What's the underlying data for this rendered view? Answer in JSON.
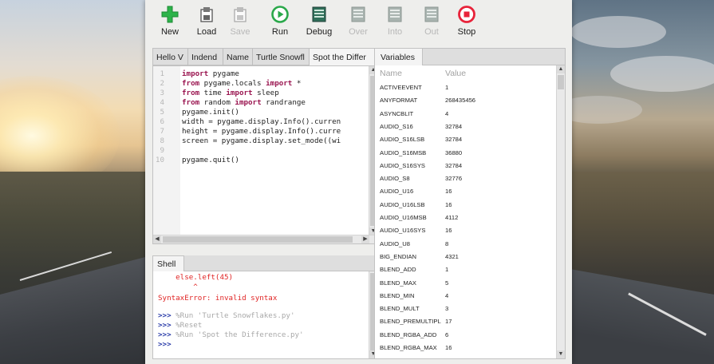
{
  "toolbar": {
    "buttons": [
      {
        "label": "New",
        "icon": "plus-icon",
        "enabled": true
      },
      {
        "label": "Load",
        "icon": "load-icon",
        "enabled": true
      },
      {
        "label": "Save",
        "icon": "save-icon",
        "enabled": false
      },
      {
        "label": "Run",
        "icon": "run-icon",
        "enabled": true
      },
      {
        "label": "Debug",
        "icon": "debug-icon",
        "enabled": true
      },
      {
        "label": "Over",
        "icon": "step-over-icon",
        "enabled": false
      },
      {
        "label": "Into",
        "icon": "step-into-icon",
        "enabled": false
      },
      {
        "label": "Out",
        "icon": "step-out-icon",
        "enabled": false
      },
      {
        "label": "Stop",
        "icon": "stop-icon",
        "enabled": true
      }
    ]
  },
  "editor": {
    "tabs": [
      "Hello V",
      "Indend",
      "Name",
      "Turtle Snowfl",
      "Spot the Differ"
    ],
    "active_tab": 4,
    "line_numbers": [
      "1",
      "2",
      "3",
      "4",
      "5",
      "6",
      "7",
      "8",
      "9",
      "10"
    ],
    "lines": [
      {
        "kw1": "import",
        "rest1": " pygame",
        "kw2": "",
        "rest2": ""
      },
      {
        "kw1": "from",
        "rest1": " pygame.locals ",
        "kw2": "import",
        "rest2": " *"
      },
      {
        "kw1": "from",
        "rest1": " time ",
        "kw2": "import",
        "rest2": " sleep"
      },
      {
        "kw1": "from",
        "rest1": " random ",
        "kw2": "import",
        "rest2": " randrange"
      },
      {
        "kw1": "",
        "rest1": "pygame.init()",
        "kw2": "",
        "rest2": ""
      },
      {
        "kw1": "",
        "rest1": "width = pygame.display.Info().curren",
        "kw2": "",
        "rest2": ""
      },
      {
        "kw1": "",
        "rest1": "height = pygame.display.Info().curre",
        "kw2": "",
        "rest2": ""
      },
      {
        "kw1": "",
        "rest1": "screen = pygame.display.set_mode((wi",
        "kw2": "",
        "rest2": ""
      },
      {
        "kw1": "",
        "rest1": "",
        "kw2": "",
        "rest2": ""
      },
      {
        "kw1": "",
        "rest1": "pygame.quit()",
        "kw2": "",
        "rest2": ""
      }
    ]
  },
  "shell": {
    "tab_label": "Shell",
    "lines": [
      {
        "prompt": "",
        "text": "    else.left(45)",
        "style": "err"
      },
      {
        "prompt": "",
        "text": "        ^",
        "style": "err"
      },
      {
        "prompt": "",
        "text": "SyntaxError: invalid syntax",
        "style": "err"
      },
      {
        "prompt": ">>>",
        "text": " %Run 'Turtle Snowflakes.py'",
        "style": "cmd"
      },
      {
        "prompt": ">>>",
        "text": " %Reset",
        "style": "cmd"
      },
      {
        "prompt": ">>>",
        "text": " %Run 'Spot the Difference.py'",
        "style": "cmd"
      },
      {
        "prompt": ">>>",
        "text": "",
        "style": "cmd"
      }
    ]
  },
  "variables": {
    "tab_label": "Variables",
    "col_name": "Name",
    "col_value": "Value",
    "rows": [
      [
        "ACTIVEEVENT",
        "1"
      ],
      [
        "ANYFORMAT",
        "268435456"
      ],
      [
        "ASYNCBLIT",
        "4"
      ],
      [
        "AUDIO_S16",
        "32784"
      ],
      [
        "AUDIO_S16LSB",
        "32784"
      ],
      [
        "AUDIO_S16MSB",
        "36880"
      ],
      [
        "AUDIO_S16SYS",
        "32784"
      ],
      [
        "AUDIO_S8",
        "32776"
      ],
      [
        "AUDIO_U16",
        "16"
      ],
      [
        "AUDIO_U16LSB",
        "16"
      ],
      [
        "AUDIO_U16MSB",
        "4112"
      ],
      [
        "AUDIO_U16SYS",
        "16"
      ],
      [
        "AUDIO_U8",
        "8"
      ],
      [
        "BIG_ENDIAN",
        "4321"
      ],
      [
        "BLEND_ADD",
        "1"
      ],
      [
        "BLEND_MAX",
        "5"
      ],
      [
        "BLEND_MIN",
        "4"
      ],
      [
        "BLEND_MULT",
        "3"
      ],
      [
        "BLEND_PREMULTIPL",
        "17"
      ],
      [
        "BLEND_RGBA_ADD",
        "6"
      ],
      [
        "BLEND_RGBA_MAX",
        "16"
      ]
    ]
  },
  "colors": {
    "run_green": "#2aa84a",
    "stop_red": "#e8233a",
    "keyword": "#9a1550",
    "error": "#e02525"
  }
}
